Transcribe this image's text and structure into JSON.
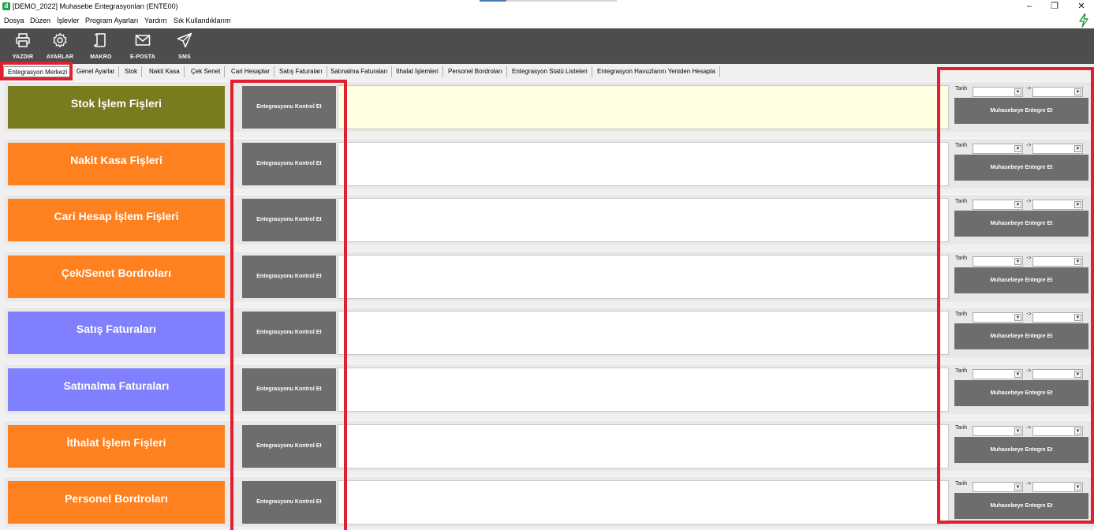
{
  "window": {
    "title": "[DEMO_2022] Muhasebe Entegrasyonları (ENTE00)",
    "app_icon": "d",
    "controls": [
      "minimize-icon",
      "maximize-icon",
      "close-icon"
    ]
  },
  "menu": [
    "Dosya",
    "Düzen",
    "İşlevler",
    "Program Ayarları",
    "Yardım",
    "Sık Kullandıklarım"
  ],
  "toolbar": [
    {
      "label": "YAZDIR",
      "icon": "printer-icon"
    },
    {
      "label": "AYARLAR",
      "icon": "gear-icon"
    },
    {
      "label": "MAKRO",
      "icon": "scroll-icon"
    },
    {
      "label": "E-POSTA",
      "icon": "envelope-icon"
    },
    {
      "label": "SMS",
      "icon": "paper-plane-icon"
    }
  ],
  "tabs": [
    "Entegrasyon Merkezi",
    "Genel Ayarlar",
    "Stok",
    "Nakit Kasa",
    "Çek Senet",
    "Cari Hesaplar",
    "Satış Faturaları",
    "Satınalma Faturaları",
    "İthalat İşlemleri",
    "Personel Bordroları",
    "Entegrasyon Statü Listeleri",
    "Entegrasyon Havuzlarını Yeniden Hesapla"
  ],
  "active_tab": "Entegrasyon Merkezi",
  "colors": {
    "olive": "#7a7a1e",
    "orange": "#ff801e",
    "purple": "#8080ff",
    "button_gray": "#6d6d6d",
    "highlight_red": "#e02030",
    "toolbar_bg": "#4d4d4d"
  },
  "rows": [
    {
      "category": "Stok İşlem Fişleri",
      "color": "#7a7a1e",
      "check_label": "Entegrasyonu Kontrol Et",
      "date_label": "Tarih",
      "date_sep": "->",
      "integrate_label": "Muhasebeye Entegre Et",
      "memo_highlight": true
    },
    {
      "category": "Nakit Kasa Fişleri",
      "color": "#ff801e",
      "check_label": "Entegrasyonu Kontrol Et",
      "date_label": "Tarih",
      "date_sep": "->",
      "integrate_label": "Muhasebeye Entegre Et",
      "memo_highlight": false
    },
    {
      "category": "Cari Hesap İşlem Fişleri",
      "color": "#ff801e",
      "check_label": "Entegrasyonu Kontrol Et",
      "date_label": "Tarih",
      "date_sep": "->",
      "integrate_label": "Muhasebeye Entegre Et",
      "memo_highlight": false
    },
    {
      "category": "Çek/Senet Bordroları",
      "color": "#ff801e",
      "check_label": "Entegrasyonu Kontrol Et",
      "date_label": "Tarih",
      "date_sep": "->",
      "integrate_label": "Muhasebeye Entegre Et",
      "memo_highlight": false
    },
    {
      "category": "Satış Faturaları",
      "color": "#8080ff",
      "check_label": "Entegrasyonu Kontrol Et",
      "date_label": "Tarih",
      "date_sep": "->",
      "integrate_label": "Muhasebeye Entegre Et",
      "memo_highlight": false
    },
    {
      "category": "Satınalma Faturaları",
      "color": "#8080ff",
      "check_label": "Entegrasyonu Kontrol Et",
      "date_label": "Tarih",
      "date_sep": "->",
      "integrate_label": "Muhasebeye Entegre Et",
      "memo_highlight": false
    },
    {
      "category": "İthalat İşlem Fişleri",
      "color": "#ff801e",
      "check_label": "Entegrasyonu Kontrol Et",
      "date_label": "Tarih",
      "date_sep": "->",
      "integrate_label": "Muhasebeye Entegre Et",
      "memo_highlight": false
    },
    {
      "category": "Personel Bordroları",
      "color": "#ff801e",
      "check_label": "Entegrasyonu Kontrol Et",
      "date_label": "Tarih",
      "date_sep": "->",
      "integrate_label": "Muhasebeye Entegre Et",
      "memo_highlight": false
    }
  ]
}
